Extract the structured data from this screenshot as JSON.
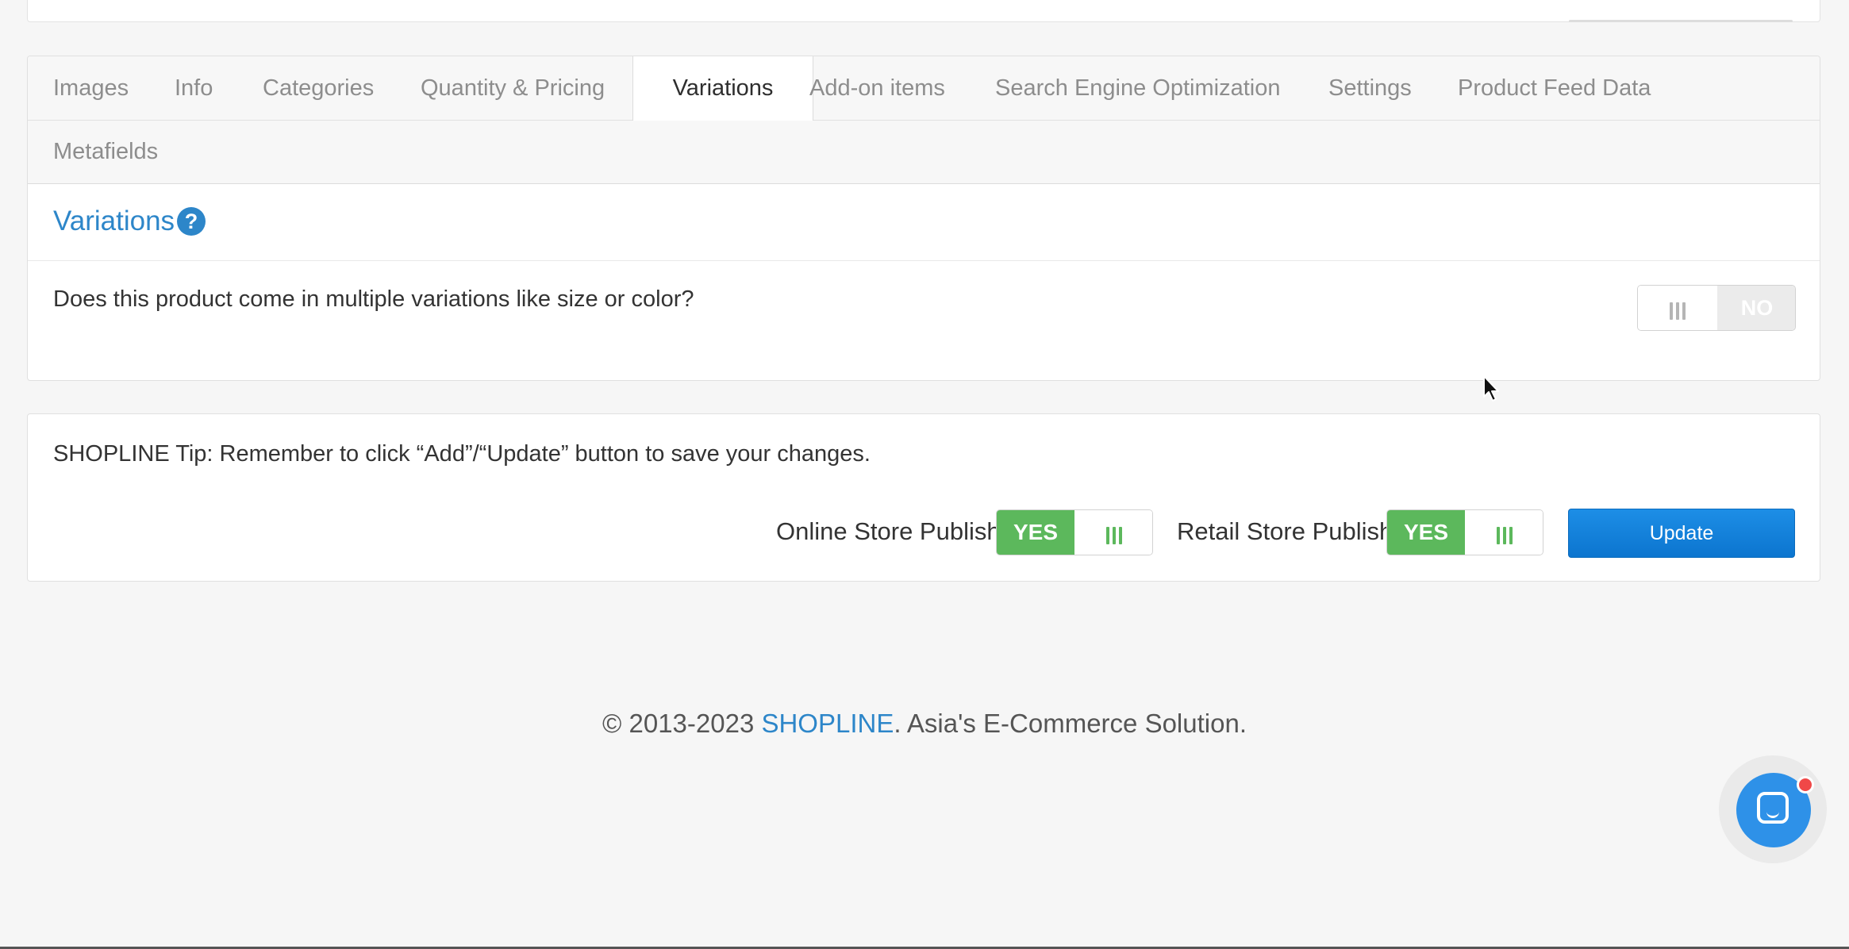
{
  "tabs": {
    "row1": [
      "Images",
      "Info",
      "Categories",
      "Quantity & Pricing",
      "Variations",
      "Add-on items",
      "Search Engine Optimization",
      "Settings",
      "Product Feed Data"
    ],
    "row2": [
      "Metafields"
    ],
    "active": "Variations"
  },
  "variations": {
    "title": "Variations",
    "help_icon": "?",
    "question": "Does this product come in multiple variations like size or color?",
    "toggle_state": "NO"
  },
  "tip": {
    "text": "SHOPLINE Tip: Remember to click “Add”/“Update” button to save your changes.",
    "online_label": "Online Store Publish",
    "online_state": "YES",
    "retail_label": "Retail Store Publish",
    "retail_state": "YES",
    "update_label": "Update"
  },
  "footer": {
    "prefix": "© 2013-2023 ",
    "brand": "SHOPLINE",
    "suffix": ". Asia's E-Commerce Solution."
  },
  "colors": {
    "accent": "#2d86c9",
    "toggle_on": "#5cb85c",
    "button": "#1a88e0",
    "notification": "#f04848"
  },
  "icons": [
    "help-icon",
    "chat-icon",
    "grip-icon",
    "mouse-cursor-icon"
  ]
}
